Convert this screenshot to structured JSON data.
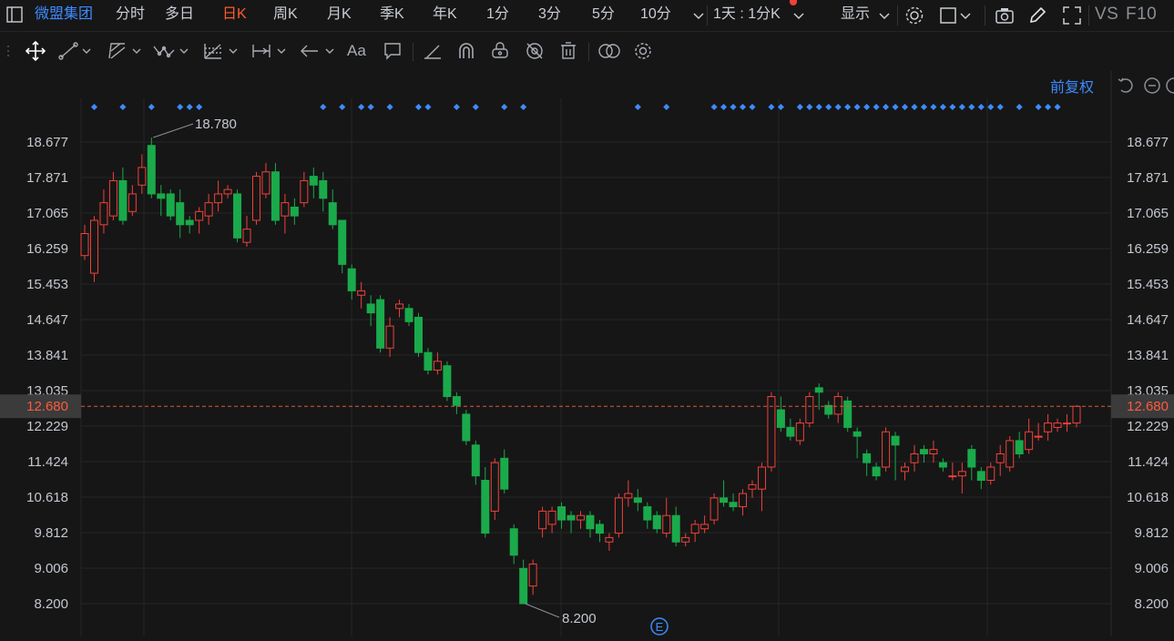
{
  "header": {
    "stock_name": "微盟集团",
    "periods": [
      "分时",
      "多日",
      "日K",
      "周K",
      "月K",
      "季K",
      "年K",
      "1分",
      "3分",
      "5分",
      "10分"
    ],
    "active_period": "日K",
    "range_select": "1天 : 1分K",
    "display_label": "显示",
    "vs_label": "VS",
    "f10_label": "F10"
  },
  "toolbar": {
    "tools": [
      "move-icon",
      "line-icon",
      "channel-icon",
      "wave-icon",
      "fib-icon",
      "measure-icon",
      "arrow-icon",
      "text-icon",
      "comment-icon",
      "eraser-icon",
      "magnet-icon",
      "lock-icon",
      "hide-icon",
      "trash-icon",
      "compare-icon",
      "settings-icon"
    ],
    "text_tool_label": "Aa"
  },
  "chart": {
    "adjust_label": "前复权",
    "colors": {
      "up": "#f0413a",
      "down": "#1aaa4b",
      "current_line": "#e2563b",
      "event_dot": "#3d8bff",
      "grid": "#262626",
      "axis_text": "#c4c8cf"
    },
    "current_price": "12.680",
    "high_label": "18.780",
    "low_label": "8.200",
    "event_marker": "E"
  },
  "chart_data": {
    "type": "candlestick",
    "ylim": [
      7.8,
      19.6
    ],
    "y_ticks": [
      "18.677",
      "17.871",
      "17.065",
      "16.259",
      "15.453",
      "14.647",
      "13.841",
      "13.035",
      "12.229",
      "11.424",
      "10.618",
      "9.812",
      "9.006",
      "8.200"
    ],
    "current_price": 12.68,
    "candles": [
      [
        16.1,
        16.6,
        16.8,
        16.0
      ],
      [
        15.7,
        16.9,
        17.0,
        15.5
      ],
      [
        16.8,
        17.3,
        17.6,
        16.6
      ],
      [
        17.0,
        17.8,
        18.0,
        16.9
      ],
      [
        17.8,
        16.9,
        18.1,
        16.8
      ],
      [
        17.1,
        17.5,
        17.7,
        17.0
      ],
      [
        17.7,
        18.1,
        18.4,
        17.5
      ],
      [
        18.6,
        17.5,
        18.78,
        17.4
      ],
      [
        17.5,
        17.4,
        17.7,
        17.0
      ],
      [
        17.5,
        17.0,
        17.6,
        16.9
      ],
      [
        17.3,
        16.8,
        17.6,
        16.5
      ],
      [
        16.9,
        16.8,
        17.0,
        16.6
      ],
      [
        16.9,
        17.1,
        17.2,
        16.6
      ],
      [
        17.0,
        17.3,
        17.5,
        16.8
      ],
      [
        17.3,
        17.5,
        17.8,
        17.1
      ],
      [
        17.5,
        17.6,
        17.7,
        17.4
      ],
      [
        17.5,
        16.5,
        17.6,
        16.4
      ],
      [
        16.4,
        16.7,
        17.0,
        16.3
      ],
      [
        16.9,
        17.9,
        18.0,
        16.8
      ],
      [
        17.5,
        18.0,
        18.2,
        17.4
      ],
      [
        18.0,
        16.9,
        18.2,
        16.8
      ],
      [
        17.0,
        17.3,
        17.5,
        16.6
      ],
      [
        17.2,
        17.0,
        17.4,
        16.8
      ],
      [
        17.3,
        17.8,
        18.0,
        17.2
      ],
      [
        17.9,
        17.7,
        18.1,
        17.4
      ],
      [
        17.8,
        17.4,
        18.0,
        17.1
      ],
      [
        17.3,
        16.8,
        17.6,
        16.7
      ],
      [
        16.9,
        15.9,
        16.9,
        15.7
      ],
      [
        15.8,
        15.3,
        15.9,
        15.1
      ],
      [
        15.2,
        15.3,
        15.5,
        14.9
      ],
      [
        15.0,
        14.8,
        15.2,
        14.5
      ],
      [
        15.1,
        14.0,
        15.2,
        13.9
      ],
      [
        14.0,
        14.5,
        14.7,
        13.8
      ],
      [
        14.9,
        15.0,
        15.1,
        14.7
      ],
      [
        14.9,
        14.6,
        15.0,
        14.5
      ],
      [
        14.7,
        13.9,
        14.8,
        13.8
      ],
      [
        13.9,
        13.5,
        14.0,
        13.4
      ],
      [
        13.5,
        13.7,
        13.9,
        13.4
      ],
      [
        13.6,
        12.9,
        13.7,
        12.8
      ],
      [
        12.9,
        12.7,
        13.0,
        12.5
      ],
      [
        12.5,
        11.9,
        12.6,
        11.8
      ],
      [
        11.8,
        11.1,
        11.9,
        10.9
      ],
      [
        11.0,
        9.8,
        11.3,
        9.7
      ],
      [
        10.3,
        11.4,
        11.5,
        10.1
      ],
      [
        11.5,
        10.8,
        11.7,
        10.7
      ],
      [
        9.9,
        9.3,
        10.0,
        9.1
      ],
      [
        9.0,
        8.2,
        9.2,
        8.2
      ],
      [
        8.6,
        9.1,
        9.2,
        8.4
      ],
      [
        9.9,
        10.3,
        10.4,
        9.7
      ],
      [
        10.0,
        10.3,
        10.4,
        9.8
      ],
      [
        10.4,
        10.1,
        10.5,
        9.9
      ],
      [
        10.2,
        10.1,
        10.3,
        9.8
      ],
      [
        10.1,
        10.2,
        10.3,
        9.9
      ],
      [
        10.2,
        9.9,
        10.3,
        9.7
      ],
      [
        10.0,
        9.8,
        10.1,
        9.6
      ],
      [
        9.6,
        9.7,
        9.8,
        9.4
      ],
      [
        9.8,
        10.6,
        10.7,
        9.7
      ],
      [
        10.6,
        10.7,
        11.0,
        10.4
      ],
      [
        10.6,
        10.5,
        10.8,
        10.3
      ],
      [
        10.4,
        10.1,
        10.5,
        9.9
      ],
      [
        10.2,
        9.9,
        10.3,
        9.8
      ],
      [
        9.8,
        10.2,
        10.6,
        9.7
      ],
      [
        10.2,
        9.6,
        10.4,
        9.5
      ],
      [
        9.6,
        9.7,
        9.8,
        9.5
      ],
      [
        9.8,
        10.0,
        10.1,
        9.6
      ],
      [
        9.9,
        10.0,
        10.2,
        9.8
      ],
      [
        10.1,
        10.6,
        10.7,
        10.0
      ],
      [
        10.6,
        10.5,
        11.0,
        10.4
      ],
      [
        10.5,
        10.4,
        10.7,
        10.3
      ],
      [
        10.4,
        10.7,
        10.8,
        10.2
      ],
      [
        10.8,
        10.9,
        11.0,
        10.6
      ],
      [
        10.8,
        11.3,
        11.4,
        10.3
      ],
      [
        11.3,
        12.9,
        13.0,
        11.2
      ],
      [
        12.6,
        12.2,
        12.9,
        12.1
      ],
      [
        12.2,
        12.0,
        12.4,
        11.9
      ],
      [
        11.9,
        12.3,
        12.4,
        11.8
      ],
      [
        12.3,
        12.9,
        13.0,
        12.2
      ],
      [
        13.1,
        13.0,
        13.2,
        12.6
      ],
      [
        12.7,
        12.5,
        12.8,
        12.4
      ],
      [
        12.5,
        12.9,
        13.0,
        12.3
      ],
      [
        12.8,
        12.2,
        12.9,
        12.1
      ],
      [
        12.1,
        12.0,
        12.2,
        11.5
      ],
      [
        11.6,
        11.4,
        11.7,
        11.1
      ],
      [
        11.3,
        11.1,
        11.4,
        11.0
      ],
      [
        11.3,
        12.1,
        12.2,
        11.2
      ],
      [
        12.0,
        11.8,
        12.1,
        11.0
      ],
      [
        11.2,
        11.3,
        11.4,
        11.0
      ],
      [
        11.4,
        11.6,
        11.8,
        11.2
      ],
      [
        11.7,
        11.6,
        11.8,
        11.4
      ],
      [
        11.6,
        11.7,
        11.9,
        11.4
      ],
      [
        11.4,
        11.3,
        11.5,
        11.2
      ],
      [
        11.1,
        11.1,
        11.4,
        11.0
      ],
      [
        11.1,
        11.2,
        11.4,
        10.7
      ],
      [
        11.7,
        11.3,
        11.8,
        11.0
      ],
      [
        11.2,
        11.0,
        11.3,
        10.8
      ],
      [
        11.0,
        11.3,
        11.4,
        10.9
      ],
      [
        11.4,
        11.6,
        11.8,
        11.1
      ],
      [
        11.3,
        11.9,
        12.0,
        11.2
      ],
      [
        11.9,
        11.6,
        12.1,
        11.5
      ],
      [
        11.7,
        12.1,
        12.4,
        11.6
      ],
      [
        12.0,
        12.0,
        12.3,
        11.9
      ],
      [
        12.1,
        12.3,
        12.5,
        11.9
      ],
      [
        12.2,
        12.3,
        12.4,
        12.1
      ],
      [
        12.3,
        12.3,
        12.5,
        12.1
      ],
      [
        12.3,
        12.68,
        12.7,
        12.2
      ]
    ]
  }
}
